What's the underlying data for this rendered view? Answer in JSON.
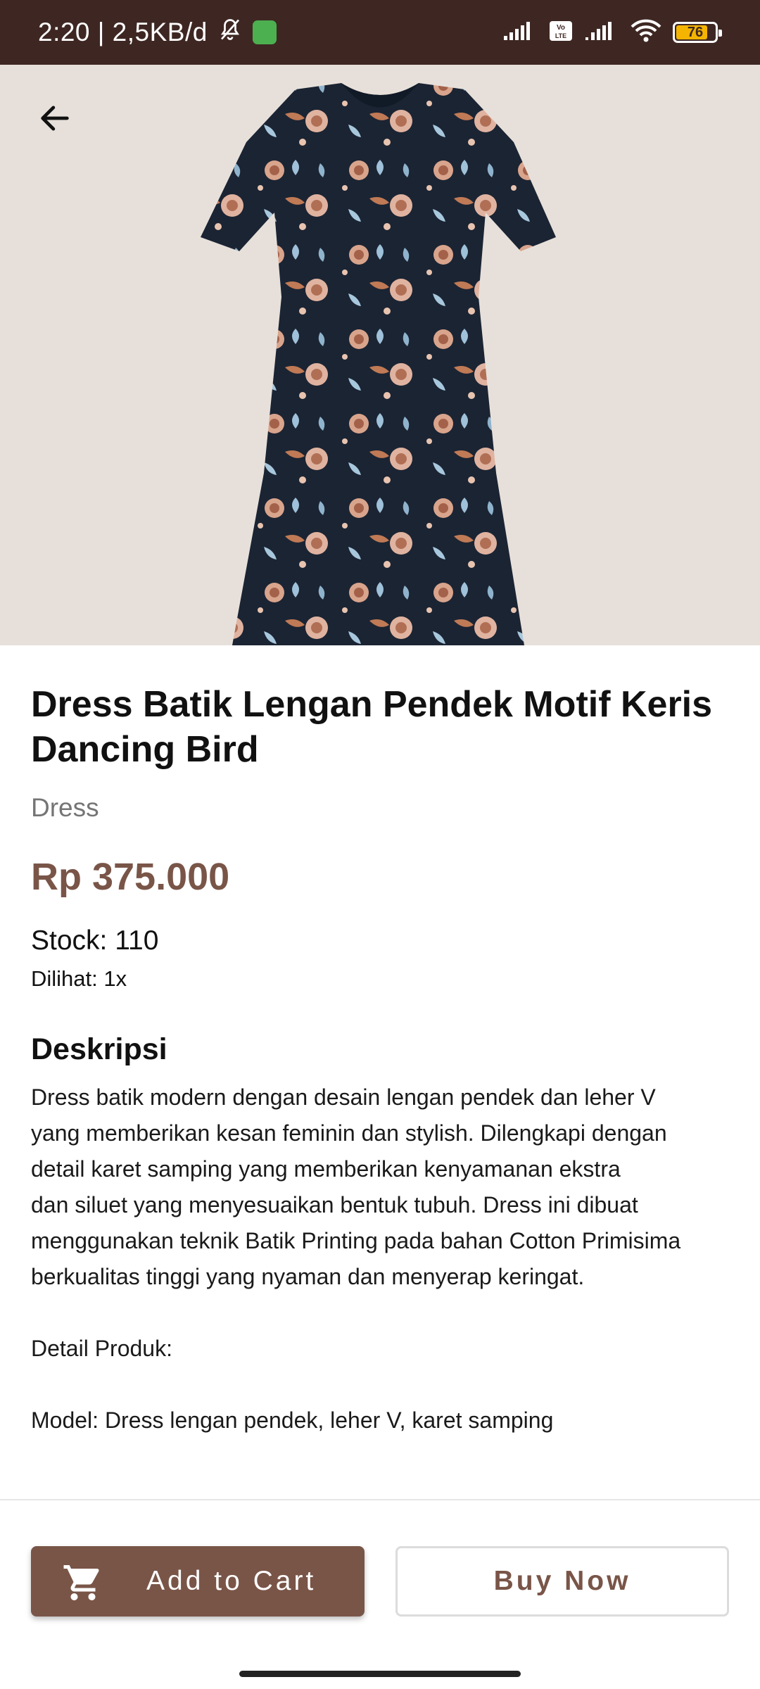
{
  "status_bar": {
    "time_speed": "2:20 | 2,5KB/d",
    "battery_level": "76",
    "icons": [
      "bell-off-icon",
      "app-badge-icon",
      "signal-icon",
      "volte-icon",
      "signal-icon",
      "wifi-icon",
      "battery-icon"
    ]
  },
  "header": {
    "back_icon": "arrow-left-icon"
  },
  "product": {
    "image_name": "batik-dress-photo",
    "title": "Dress Batik Lengan Pendek Motif Keris Dancing Bird",
    "category": "Dress",
    "price": "Rp 375.000",
    "stock": "Stock: 110",
    "views": "Dilihat: 1x"
  },
  "description": {
    "heading": "Deskripsi",
    "lines": [
      "Dress batik modern dengan desain lengan pendek dan leher V",
      "yang memberikan kesan feminin dan stylish. Dilengkapi dengan",
      "detail karet samping yang memberikan kenyamanan ekstra",
      "dan siluet yang menyesuaikan bentuk tubuh. Dress ini dibuat",
      "menggunakan teknik Batik Printing pada bahan Cotton Primisima",
      "berkualitas tinggi yang nyaman dan menyerap keringat."
    ],
    "detail_heading": "Detail Produk:",
    "model_line": "Model: Dress lengan pendek, leher V, karet samping"
  },
  "actions": {
    "add_to_cart_label": "Add to Cart",
    "cart_icon": "shopping-cart-icon",
    "buy_now_label": "Buy Now"
  },
  "colors": {
    "status_bar_bg": "#3e2723",
    "hero_bg": "#e7e0da",
    "accent_brown": "#795548",
    "dress_navy": "#1b2433"
  }
}
